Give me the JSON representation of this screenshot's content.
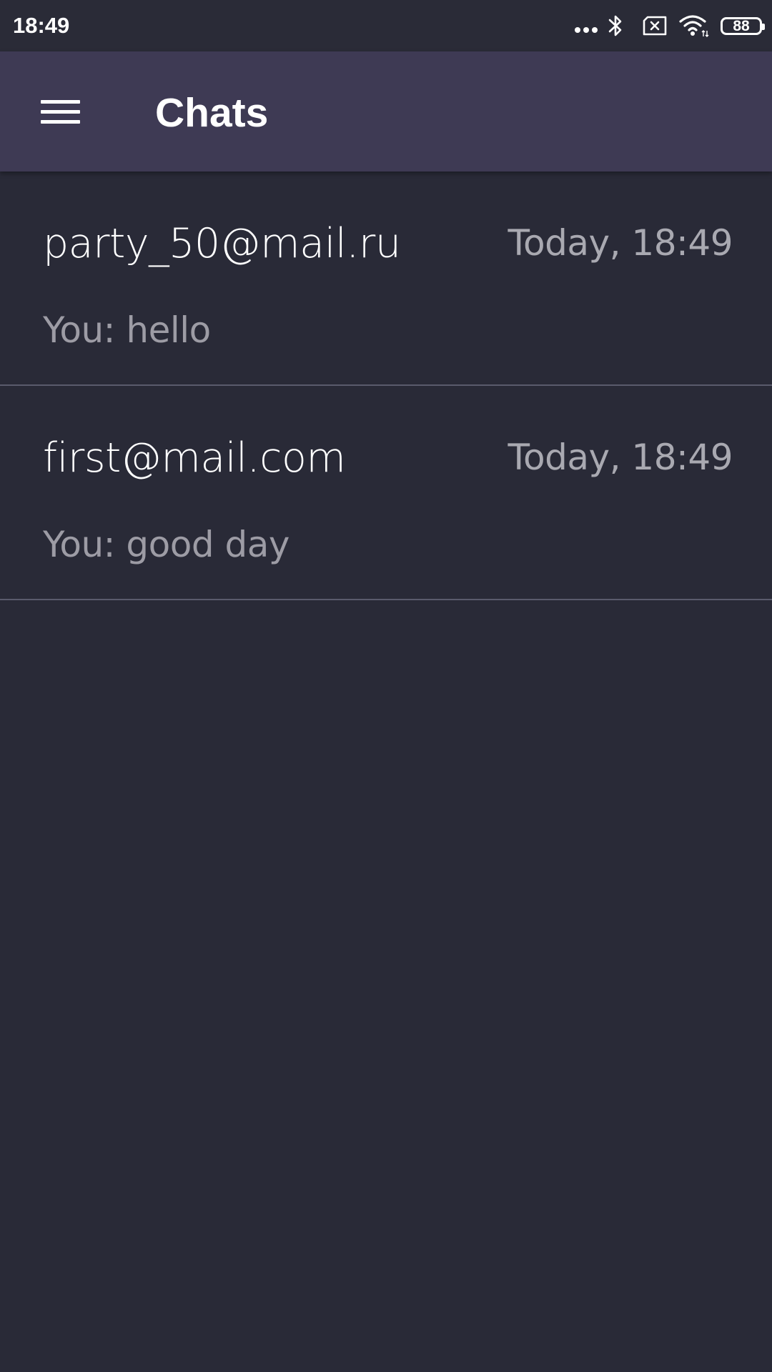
{
  "status_bar": {
    "time": "18:49",
    "battery_level": "88",
    "icons": [
      "more-dots-icon",
      "bluetooth-icon",
      "sim-disabled-icon",
      "wifi-icon",
      "battery-icon"
    ]
  },
  "app_bar": {
    "title": "Chats",
    "menu_icon": "hamburger-menu-icon"
  },
  "chats": [
    {
      "name": "party_50@mail.ru",
      "time": "Today, 18:49",
      "preview": "You: hello"
    },
    {
      "name": "first@mail.com",
      "time": "Today, 18:49",
      "preview": "You: good day"
    }
  ],
  "colors": {
    "background": "#292a37",
    "app_bar": "#3e3a54",
    "divider": "#5a5b6c",
    "secondary_text": "#a9a9b1"
  }
}
